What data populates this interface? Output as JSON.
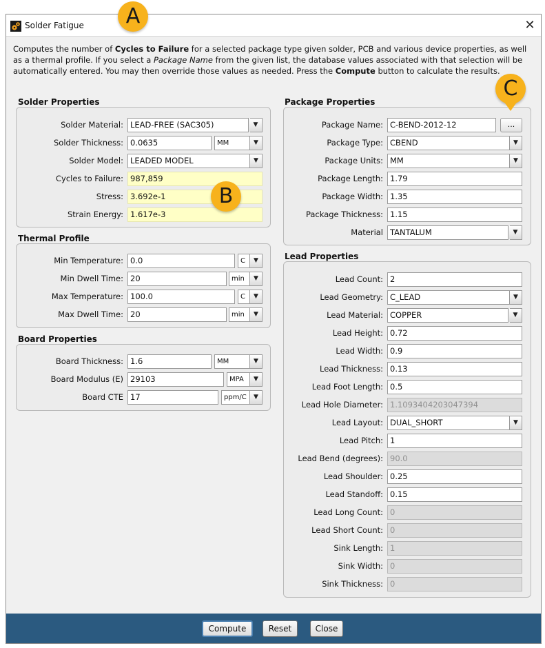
{
  "window": {
    "title": "Solder Fatigue",
    "close_glyph": "✕"
  },
  "description": {
    "p1": "Computes the number of ",
    "b1": "Cycles to Failure",
    "p2": " for a selected package type given solder, PCB and various device properties, as well as a thermal profile. If you select a ",
    "i1": "Package Name",
    "p3": " from the given list, the database values associated with that selection will be automatically entered. You may then override those values as needed. Press the ",
    "b2": "Compute",
    "p4": " button to calculate the results."
  },
  "solder": {
    "title": "Solder Properties",
    "material_label": "Solder Material:",
    "material_value": "LEAD-FREE (SAC305)",
    "thickness_label": "Solder Thickness:",
    "thickness_value": "0.0635",
    "thickness_unit": "MM",
    "model_label": "Solder Model:",
    "model_value": "LEADED MODEL",
    "cycles_label": "Cycles to Failure:",
    "cycles_value": "987,859",
    "stress_label": "Stress:",
    "stress_value": "3.692e-1",
    "strain_label": "Strain Energy:",
    "strain_value": "1.617e-3"
  },
  "thermal": {
    "title": "Thermal Profile",
    "min_temp_label": "Min Temperature:",
    "min_temp_value": "0.0",
    "min_temp_unit": "C",
    "min_dwell_label": "Min Dwell Time:",
    "min_dwell_value": "20",
    "min_dwell_unit": "min",
    "max_temp_label": "Max Temperature:",
    "max_temp_value": "100.0",
    "max_temp_unit": "C",
    "max_dwell_label": "Max Dwell Time:",
    "max_dwell_value": "20",
    "max_dwell_unit": "min"
  },
  "board": {
    "title": "Board Properties",
    "thickness_label": "Board Thickness:",
    "thickness_value": "1.6",
    "thickness_unit": "MM",
    "modulus_label": "Board Modulus (E)",
    "modulus_value": "29103",
    "modulus_unit": "MPA",
    "cte_label": "Board CTE",
    "cte_value": "17",
    "cte_unit": "ppm/C"
  },
  "package": {
    "title": "Package Properties",
    "name_label": "Package Name:",
    "name_value": "C-BEND-2012-12",
    "browse_label": "...",
    "type_label": "Package Type:",
    "type_value": "CBEND",
    "units_label": "Package Units:",
    "units_value": "MM",
    "length_label": "Package Length:",
    "length_value": "1.79",
    "width_label": "Package Width:",
    "width_value": "1.35",
    "thickness_label": "Package Thickness:",
    "thickness_value": "1.15",
    "material_label": "Material",
    "material_value": "TANTALUM"
  },
  "lead": {
    "title": "Lead Properties",
    "rows": [
      {
        "label": "Lead Count:",
        "value": "2",
        "kind": "text"
      },
      {
        "label": "Lead Geometry:",
        "value": "C_LEAD",
        "kind": "combo"
      },
      {
        "label": "Lead Material:",
        "value": "COPPER",
        "kind": "combo2"
      },
      {
        "label": "Lead Height:",
        "value": "0.72",
        "kind": "text"
      },
      {
        "label": "Lead Width:",
        "value": "0.9",
        "kind": "text"
      },
      {
        "label": "Lead Thickness:",
        "value": "0.13",
        "kind": "text"
      },
      {
        "label": "Lead Foot Length:",
        "value": "0.5",
        "kind": "text"
      },
      {
        "label": "Lead Hole Diameter:",
        "value": "1.1093404203047394",
        "kind": "disabled"
      },
      {
        "label": "Lead Layout:",
        "value": "DUAL_SHORT",
        "kind": "combo"
      },
      {
        "label": "Lead Pitch:",
        "value": "1",
        "kind": "text"
      },
      {
        "label": "Lead Bend (degrees):",
        "value": "90.0",
        "kind": "disabled"
      },
      {
        "label": "Lead Shoulder:",
        "value": "0.25",
        "kind": "text"
      },
      {
        "label": "Lead Standoff:",
        "value": "0.15",
        "kind": "text"
      },
      {
        "label": "Lead Long Count:",
        "value": "0",
        "kind": "disabled"
      },
      {
        "label": "Lead Short Count:",
        "value": "0",
        "kind": "disabled"
      },
      {
        "label": "Sink Length:",
        "value": "1",
        "kind": "disabled"
      },
      {
        "label": "Sink Width:",
        "value": "0",
        "kind": "disabled"
      },
      {
        "label": "Sink Thickness:",
        "value": "0",
        "kind": "disabled"
      }
    ]
  },
  "buttons": {
    "compute": "Compute",
    "reset": "Reset",
    "close": "Close"
  },
  "callouts": {
    "a": "A",
    "b": "B",
    "c": "C"
  },
  "colors": {
    "accent_callout": "#f7b21c",
    "footer": "#2b5a80",
    "result_field": "#ffffc6"
  },
  "icons": {
    "combo_arrow": "▼",
    "app": "gears-icon"
  }
}
